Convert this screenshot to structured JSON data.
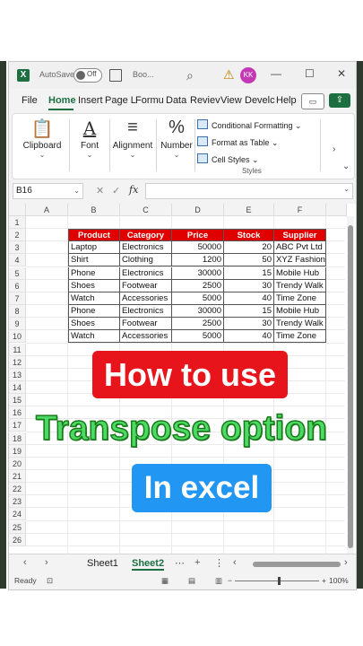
{
  "title_bar": {
    "logo": "X",
    "autosave_label": "AutoSave",
    "autosave_state": "Off",
    "book_title": "Boo...",
    "avatar_initials": "KK",
    "controls": [
      "—",
      "☐",
      "✕"
    ]
  },
  "menu": {
    "tabs": [
      "File",
      "Home",
      "Insert",
      "Page L",
      "Formu",
      "Data",
      "Reviev",
      "View",
      "Develc",
      "Help"
    ],
    "active_tab": "Home"
  },
  "ribbon": {
    "clipboard_label": "Clipboard",
    "font_label": "Font",
    "alignment_label": "Alignment",
    "number_label": "Number",
    "conditional_formatting": "Conditional Formatting",
    "format_as_table": "Format as Table",
    "cell_styles": "Cell Styles",
    "styles_label": "Styles"
  },
  "formula_bar": {
    "name_box": "B16",
    "fx": "fx",
    "value": ""
  },
  "grid": {
    "columns": [
      "A",
      "B",
      "C",
      "D",
      "E",
      "F"
    ],
    "rows": [
      "1",
      "2",
      "3",
      "4",
      "5",
      "6",
      "7",
      "8",
      "9",
      "10",
      "11",
      "12",
      "13",
      "14",
      "15",
      "16",
      "17",
      "18",
      "19",
      "20",
      "21",
      "22",
      "23",
      "24",
      "25",
      "26"
    ]
  },
  "table": {
    "headers": [
      "Product",
      "Category",
      "Price",
      "Stock",
      "Supplier"
    ],
    "rows": [
      [
        "Laptop",
        "Electronics",
        "50000",
        "20",
        "ABC Pvt Ltd"
      ],
      [
        "Shirt",
        "Clothing",
        "1200",
        "50",
        "XYZ Fashions"
      ],
      [
        "Phone",
        "Electronics",
        "30000",
        "15",
        "Mobile Hub"
      ],
      [
        "Shoes",
        "Footwear",
        "2500",
        "30",
        "Trendy Walk"
      ],
      [
        "Watch",
        "Accessories",
        "5000",
        "40",
        "Time Zone"
      ],
      [
        "Phone",
        "Electronics",
        "30000",
        "15",
        "Mobile Hub"
      ],
      [
        "Shoes",
        "Footwear",
        "2500",
        "30",
        "Trendy Walk"
      ],
      [
        "Watch",
        "Accessories",
        "5000",
        "40",
        "Time Zone"
      ]
    ]
  },
  "sheet_tabs": {
    "tabs": [
      "Sheet1",
      "Sheet2"
    ],
    "active": "Sheet2"
  },
  "status_bar": {
    "ready": "Ready",
    "zoom": "100%"
  },
  "overlay": {
    "line1": "How to use",
    "line2": "Transpose option",
    "line3": "In excel"
  },
  "colors": {
    "excel_green": "#1d6f42",
    "header_red": "#e00000",
    "banner_red": "#e8141b",
    "banner_green": "#4cd964",
    "banner_blue": "#2196f3"
  }
}
